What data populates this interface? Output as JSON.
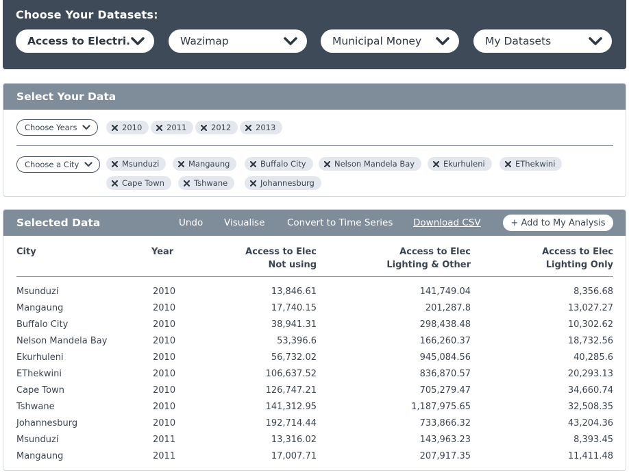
{
  "datasets": {
    "heading": "Choose Your Datasets:",
    "selects": [
      {
        "label": "Access to Electri...",
        "bold": true
      },
      {
        "label": "Wazimap",
        "bold": false
      },
      {
        "label": "Municipal Money",
        "bold": false
      },
      {
        "label": "My Datasets",
        "bold": false
      }
    ]
  },
  "select_data": {
    "heading": "Select Your Data",
    "years_button": "Choose Years",
    "years": [
      "2010",
      "2011",
      "2012",
      "2013"
    ],
    "city_button": "Choose a City",
    "cities": [
      "Msunduzi",
      "Mangaung",
      "Buffalo City",
      "Nelson Mandela Bay",
      "Ekurhuleni",
      "EThekwini",
      "Cape Town",
      "Tshwane",
      "Johannesburg"
    ]
  },
  "selected_data": {
    "heading": "Selected Data",
    "actions": {
      "undo": "Undo",
      "visualise": "Visualise",
      "convert": "Convert to Time Series",
      "download": "Download CSV",
      "add": "+ Add to My Analysis"
    },
    "columns": {
      "city": "City",
      "year": "Year",
      "not_using_1": "Access to Elec",
      "not_using_2": "Not using",
      "lighting_other_1": "Access to Elec",
      "lighting_other_2": "Lighting & Other",
      "lighting_only_1": "Access to Elec",
      "lighting_only_2": "Lighting Only"
    },
    "rows": [
      {
        "city": "Msunduzi",
        "year": "2010",
        "not_using": "13,846.61",
        "lighting_other": "141,749.04",
        "lighting_only": "8,356.68"
      },
      {
        "city": "Mangaung",
        "year": "2010",
        "not_using": "17,740.15",
        "lighting_other": "201,287.8",
        "lighting_only": "13,027.27"
      },
      {
        "city": "Buffalo City",
        "year": "2010",
        "not_using": "38,941.31",
        "lighting_other": "298,438.48",
        "lighting_only": "10,302.62"
      },
      {
        "city": "Nelson Mandela Bay",
        "year": "2010",
        "not_using": "53,396.6",
        "lighting_other": "166,260.37",
        "lighting_only": "18,732.56"
      },
      {
        "city": "Ekurhuleni",
        "year": "2010",
        "not_using": "56,732.02",
        "lighting_other": "945,084.56",
        "lighting_only": "40,285.6"
      },
      {
        "city": "EThekwini",
        "year": "2010",
        "not_using": "106,637.52",
        "lighting_other": "836,870.57",
        "lighting_only": "20,293.13"
      },
      {
        "city": "Cape Town",
        "year": "2010",
        "not_using": "126,747.21",
        "lighting_other": "705,279.47",
        "lighting_only": "34,660.74"
      },
      {
        "city": "Tshwane",
        "year": "2010",
        "not_using": "141,312.95",
        "lighting_other": "1,187,975.65",
        "lighting_only": "32,508.35"
      },
      {
        "city": "Johannesburg",
        "year": "2010",
        "not_using": "192,714.44",
        "lighting_other": "733,866.32",
        "lighting_only": "43,204.36"
      },
      {
        "city": "Msunduzi",
        "year": "2011",
        "not_using": "13,316.02",
        "lighting_other": "143,963.23",
        "lighting_only": "8,393.45"
      },
      {
        "city": "Mangaung",
        "year": "2011",
        "not_using": "17,007.71",
        "lighting_other": "207,917.35",
        "lighting_only": "11,411.48"
      }
    ]
  }
}
